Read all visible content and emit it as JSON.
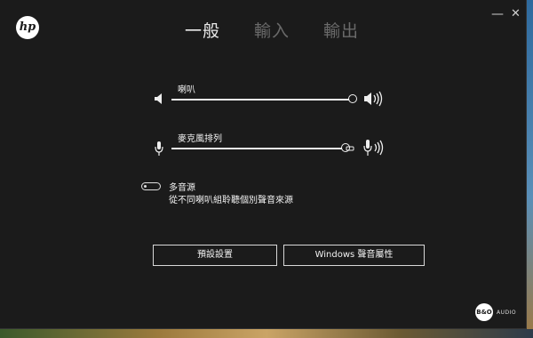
{
  "window": {
    "logo_text": "hp",
    "minimize_glyph": "—",
    "close_glyph": "✕"
  },
  "tabs": [
    {
      "label": "一般",
      "active": true
    },
    {
      "label": "輸入",
      "active": false
    },
    {
      "label": "輸出",
      "active": false
    }
  ],
  "speaker": {
    "label": "喇叭",
    "level_percent": 100,
    "icon_low": "speaker-low-icon",
    "icon_high": "speaker-high-icon"
  },
  "microphone": {
    "label": "麥克風排列",
    "level_percent": 100,
    "icon_low": "microphone-icon",
    "icon_high": "microphone-high-icon"
  },
  "multi_source": {
    "title": "多音源",
    "description": "從不同喇叭組聆聽個別聲音來源",
    "enabled": false
  },
  "buttons": {
    "preset": "預設設置",
    "windows_sound": "Windows 聲音屬性"
  },
  "branding": {
    "bo_text": "B&O",
    "audio_text": "AUDIO"
  },
  "colors": {
    "background": "#1b1b1b",
    "active_tab": "#e9e9e9",
    "inactive_tab": "#6a6a6a",
    "foreground": "#f2f2f2"
  }
}
